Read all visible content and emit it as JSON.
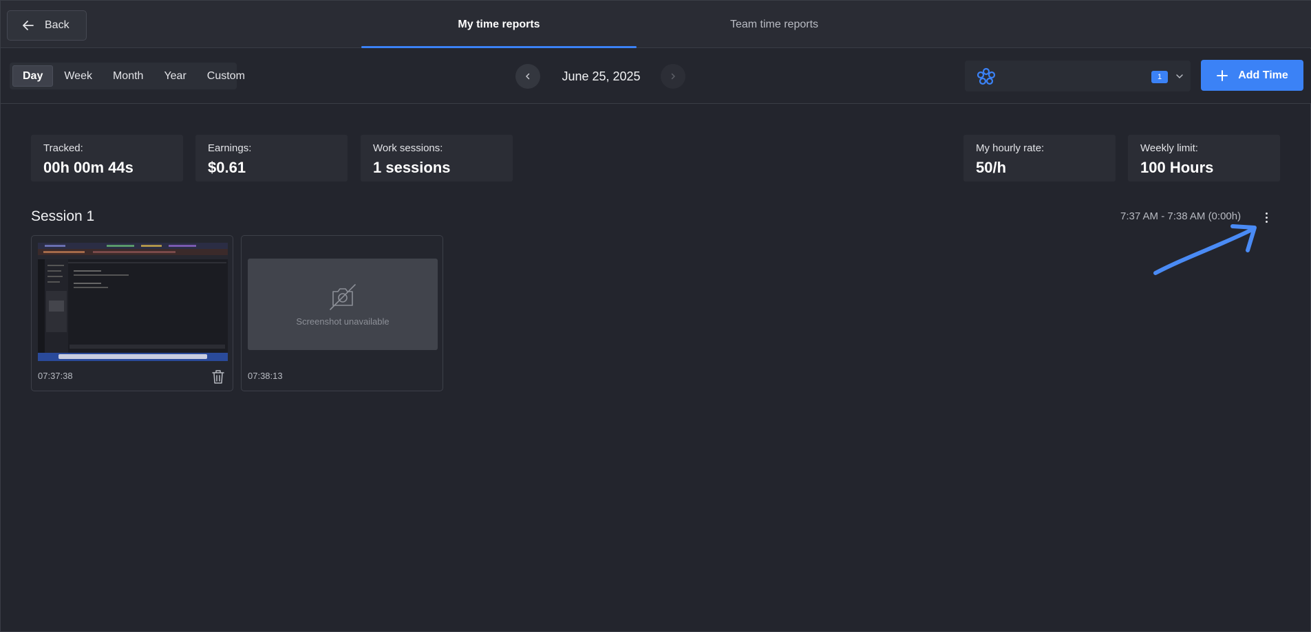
{
  "header": {
    "back_label": "Back",
    "tabs": [
      {
        "label": "My time reports",
        "active": true
      },
      {
        "label": "Team time reports",
        "active": false
      }
    ]
  },
  "filters": {
    "periods": [
      "Day",
      "Week",
      "Month",
      "Year",
      "Custom"
    ],
    "active_period": "Day",
    "date": "June 25, 2025",
    "project_count": "1",
    "add_time_label": "Add Time"
  },
  "stats": {
    "tracked": {
      "label": "Tracked:",
      "value": "00h 00m 44s"
    },
    "earnings": {
      "label": "Earnings:",
      "value": "$0.61"
    },
    "sessions": {
      "label": "Work sessions:",
      "value": "1 sessions"
    },
    "hourly_rate": {
      "label": "My hourly rate:",
      "value": "50/h"
    },
    "weekly_limit": {
      "label": "Weekly limit:",
      "value": "100 Hours"
    }
  },
  "session": {
    "title": "Session 1",
    "time_range": "7:37 AM - 7:38 AM (0:00h)",
    "screenshots": [
      {
        "time": "07:37:38",
        "available": true
      },
      {
        "time": "07:38:13",
        "available": false,
        "unavailable_text": "Screenshot unavailable"
      }
    ]
  },
  "colors": {
    "accent": "#3b82f6",
    "background": "#23252d"
  }
}
